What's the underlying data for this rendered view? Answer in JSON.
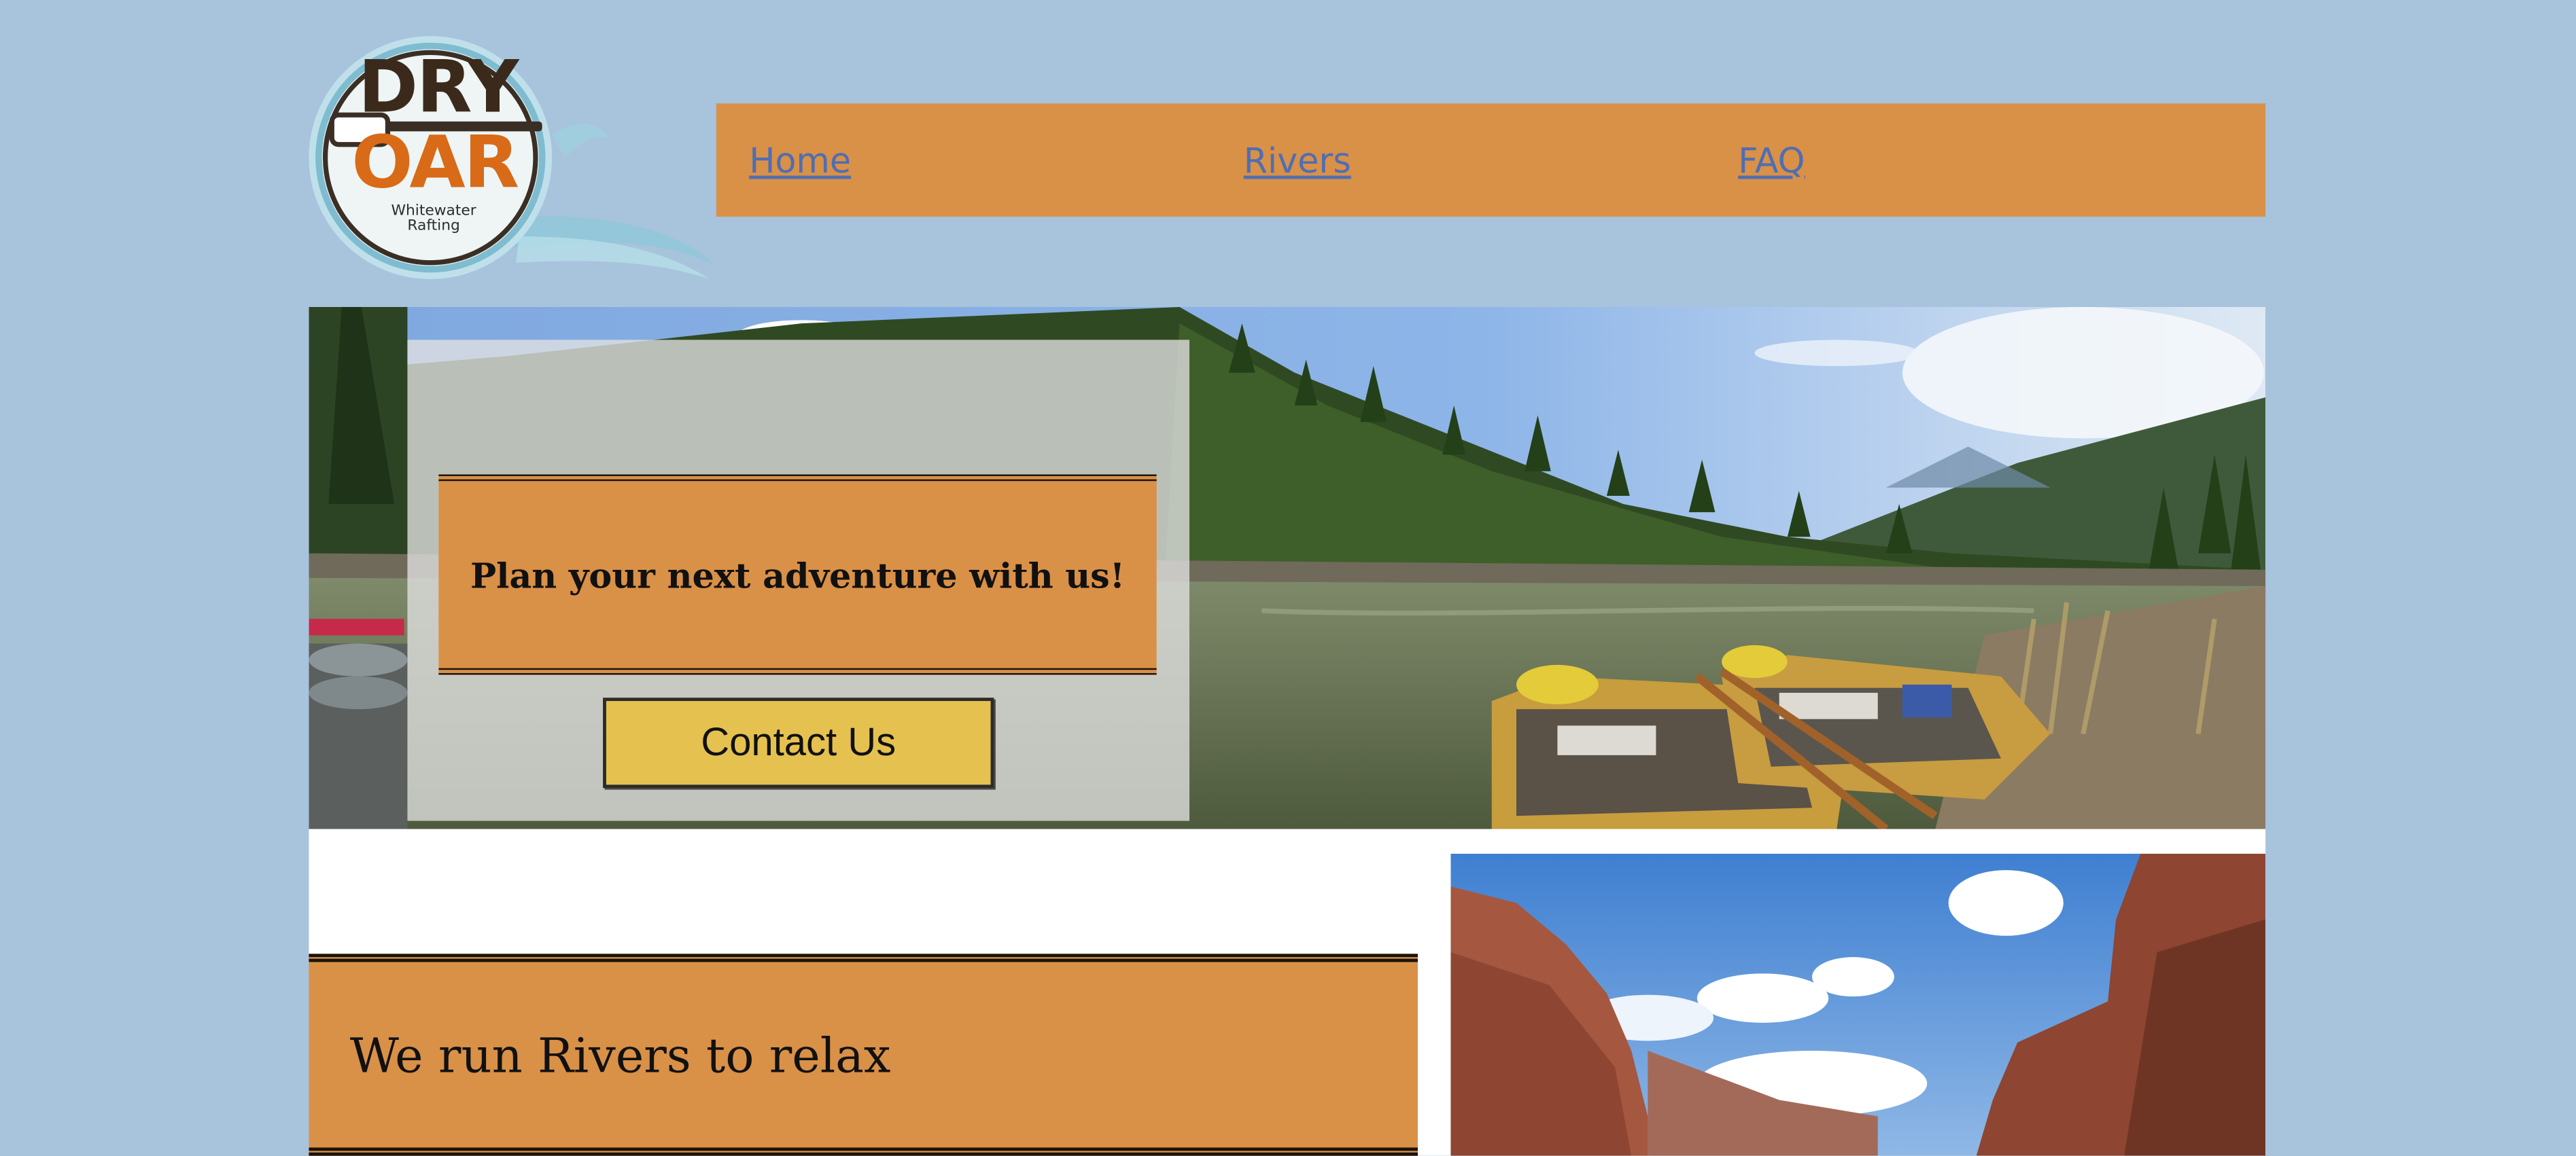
{
  "logo": {
    "line1": "DRY",
    "line2": "OAR",
    "subtitle_line1": "Whitewater",
    "subtitle_line2": "Rafting"
  },
  "nav": {
    "items": [
      {
        "label": "Home"
      },
      {
        "label": "Rivers"
      },
      {
        "label": "FAQ"
      }
    ]
  },
  "hero": {
    "tagline": "Plan your next adventure with us!",
    "cta_label": "Contact Us"
  },
  "section": {
    "heading": "We run Rivers to relax"
  },
  "colors": {
    "background": "#a8c3dc",
    "accent_orange": "#d99047",
    "button_yellow": "#e5c14f",
    "link_blue": "#4f6eb3"
  }
}
